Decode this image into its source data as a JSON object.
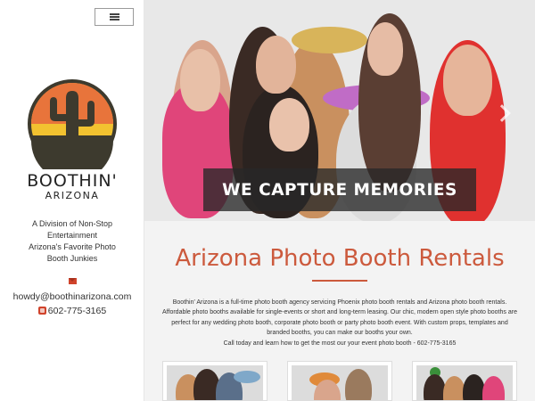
{
  "sidebar": {
    "menu_icon": "hamburger-icon",
    "logo_icon": "cactus-sun-logo",
    "brand_name": "BOOTHIN'",
    "brand_sub": "ARIZONA",
    "tagline_1": "A Division of Non-Stop",
    "tagline_2": "Entertainment",
    "tagline_3": "Arizona's Favorite Photo",
    "tagline_4": "Booth Junkies",
    "email": "howdy@boothinarizona.com",
    "phone": "602-775-3165"
  },
  "hero": {
    "caption": "WE CAPTURE MEMORIES"
  },
  "main": {
    "title": "Arizona Photo Booth Rentals",
    "line_1": "Boothin' Arizona is a full-time photo booth agency servicing Phoenix photo booth rentals and Arizona photo booth rentals.",
    "line_2": "Affordable photo booths available for single-events or short and long-term leasing. Our chic, modern open style photo booths are",
    "line_3": "perfect for any wedding photo booth, corporate photo booth or party photo booth event. With custom props, templates and",
    "line_4": "branded booths, you can make our booths your own.",
    "line_5": "Call today and learn how to get the most our your event photo booth - 602-775-3165"
  },
  "colors": {
    "accent": "#cc5a3d",
    "logo_orange": "#e8743b",
    "logo_yellow": "#f2c230",
    "logo_dark": "#3d3a2e"
  }
}
